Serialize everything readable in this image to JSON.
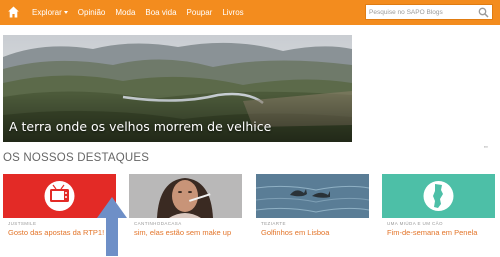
{
  "nav": {
    "items": [
      {
        "label": "Explorar",
        "has_caret": true
      },
      {
        "label": "Opinião"
      },
      {
        "label": "Moda"
      },
      {
        "label": "Boa vida"
      },
      {
        "label": "Poupar"
      },
      {
        "label": "Livros"
      }
    ],
    "home_icon": "home-icon"
  },
  "search": {
    "placeholder": "Pesquise no SAPO Blogs",
    "value": "",
    "icon": "search-icon"
  },
  "hero": {
    "title": "A terra onde os velhos morrem de velhice"
  },
  "section": {
    "title": "OS NOSSOS DESTAQUES"
  },
  "cards": [
    {
      "author": "JUSTSMILE",
      "title": "Gosto das apostas da RTP1!",
      "icon": "tv-icon",
      "bg": "#e32a26"
    },
    {
      "author": "CANTINHODACASA",
      "title": "sim, elas estão sem make up"
    },
    {
      "author": "TEZIARTE",
      "title": "Golfinhos em Lisboa"
    },
    {
      "author": "UMA MIÚDA E UM CÃO",
      "title": "Fim-de-semana em Penela",
      "icon": "portugal-map-icon",
      "bg": "#4dbfa7"
    }
  ],
  "colors": {
    "brand": "#f38c1e",
    "link": "#e3752a",
    "pointer_arrow": "#6e8fc7"
  }
}
